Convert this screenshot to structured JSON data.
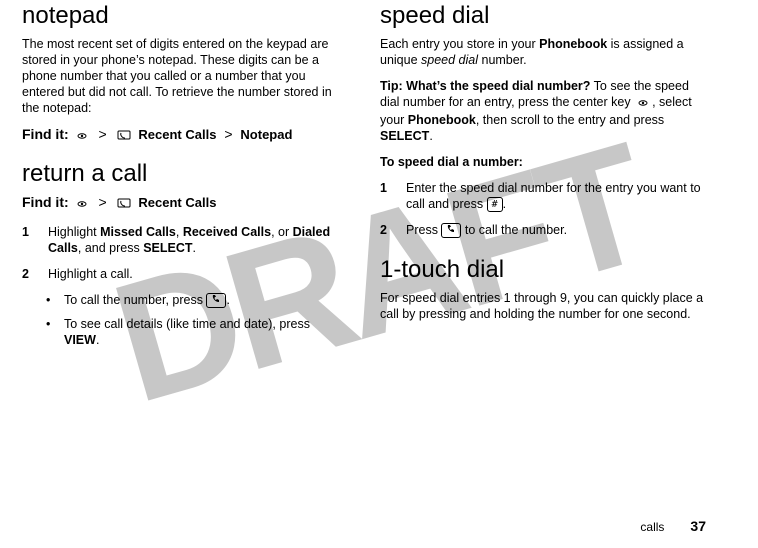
{
  "watermark": "DRAFT",
  "left": {
    "h1": "notepad",
    "p1": "The most recent set of digits entered on the keypad are stored in your phone’s notepad. These digits can be a phone number that you called or a number that you entered but did not call. To retrieve the number stored in the notepad:",
    "find1_label": "Find it:",
    "find1_path1": "Recent Calls",
    "find1_path2": "Notepad",
    "h2": "return a call",
    "find2_label": "Find it:",
    "find2_path1": "Recent Calls",
    "step1_num": "1",
    "step1_a": "Highlight ",
    "step1_b": "Missed Calls",
    "step1_c": ", ",
    "step1_d": "Received Calls",
    "step1_e": ", or ",
    "step1_f": "Dialed Calls",
    "step1_g": ", and press ",
    "step1_h": "SELECT",
    "step1_i": ".",
    "step2_num": "2",
    "step2_text": "Highlight a call.",
    "bullet1_a": "To call the number, press ",
    "bullet1_b": ".",
    "bullet2_a": "To see call details (like time and date), press ",
    "bullet2_b": "VIEW",
    "bullet2_c": "."
  },
  "right": {
    "h1": "speed dial",
    "p1_a": "Each entry you store in your ",
    "p1_b": "Phonebook",
    "p1_c": " is assigned a unique ",
    "p1_d": "speed dial",
    "p1_e": " number.",
    "p2_a": "Tip: What’s the speed dial number?",
    "p2_b": " To see the speed dial number for an entry, press the center key ",
    "p2_c": ", select your ",
    "p2_d": "Phonebook",
    "p2_e": ", then scroll to the entry and press ",
    "p2_f": "SELECT",
    "p2_g": ".",
    "p3": "To speed dial a number:",
    "step1_num": "1",
    "step1_a": "Enter the speed dial number for the entry you want to call and press ",
    "step1_key": "#",
    "step1_b": ".",
    "step2_num": "2",
    "step2_a": "Press ",
    "step2_b": " to call the number.",
    "h2": "1-touch dial",
    "p4": "For speed dial entries 1 through 9, you can quickly place a call by pressing and holding the number for one second."
  },
  "footer": {
    "label": "calls",
    "page": "37"
  },
  "glyphs": {
    "gt": ">",
    "bullet": "•"
  }
}
